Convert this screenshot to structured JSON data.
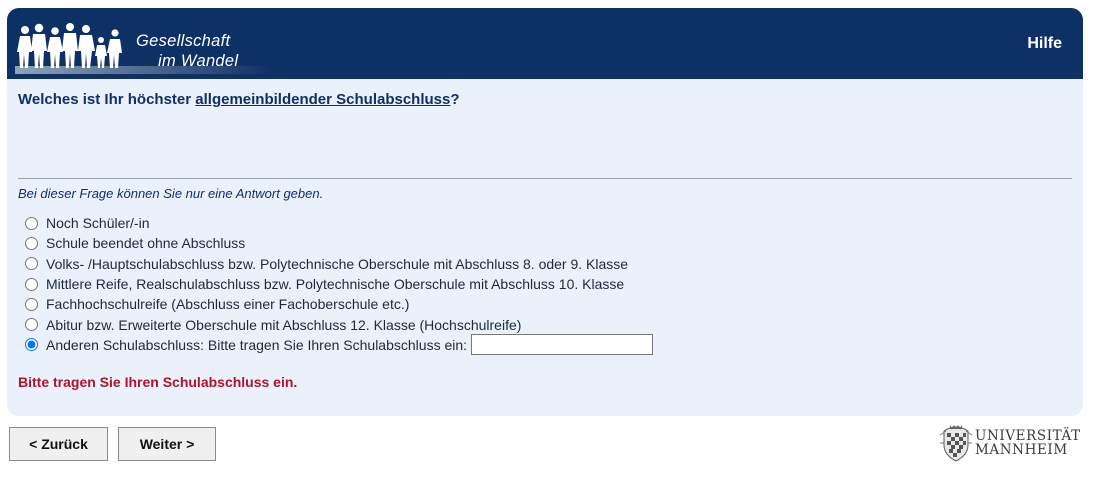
{
  "header": {
    "logo_line1": "Gesellschaft",
    "logo_line2": "im Wandel",
    "help_label": "Hilfe"
  },
  "question": {
    "prefix": "Welches ist Ihr höchster ",
    "emphasis": "allgemeinbildender Schulabschluss",
    "suffix": "?",
    "instruction": "Bei dieser Frage können Sie nur eine Antwort geben."
  },
  "options": [
    {
      "label": "Noch Schüler/-in",
      "selected": false
    },
    {
      "label": "Schule beendet ohne Abschluss",
      "selected": false
    },
    {
      "label": "Volks- /Hauptschulabschluss bzw. Polytechnische Oberschule mit Abschluss 8. oder 9. Klasse",
      "selected": false
    },
    {
      "label": "Mittlere Reife, Realschulabschluss bzw. Polytechnische Oberschule mit Abschluss 10. Klasse",
      "selected": false
    },
    {
      "label": "Fachhochschulreife (Abschluss einer Fachoberschule etc.)",
      "selected": false
    },
    {
      "label": "Abitur bzw. Erweiterte Oberschule mit Abschluss 12. Klasse (Hochschulreife)",
      "selected": false
    },
    {
      "label": "Anderen Schulabschluss: Bitte tragen Sie Ihren Schulabschluss ein:",
      "selected": true
    }
  ],
  "other_input": {
    "value": "",
    "placeholder": ""
  },
  "error_message": "Bitte tragen Sie Ihren Schulabschluss ein.",
  "navigation": {
    "back_label": "< Zurück",
    "next_label": "Weiter >"
  },
  "university": {
    "line1": "UNIVERSITÄT",
    "line2": "MANNHEIM"
  },
  "colors": {
    "header_bg": "#0e3165",
    "panel_bg": "#eaf1fb",
    "error": "#b0132e"
  },
  "icons": {
    "logo": "people-silhouettes-logo",
    "crest": "university-crest-icon"
  }
}
